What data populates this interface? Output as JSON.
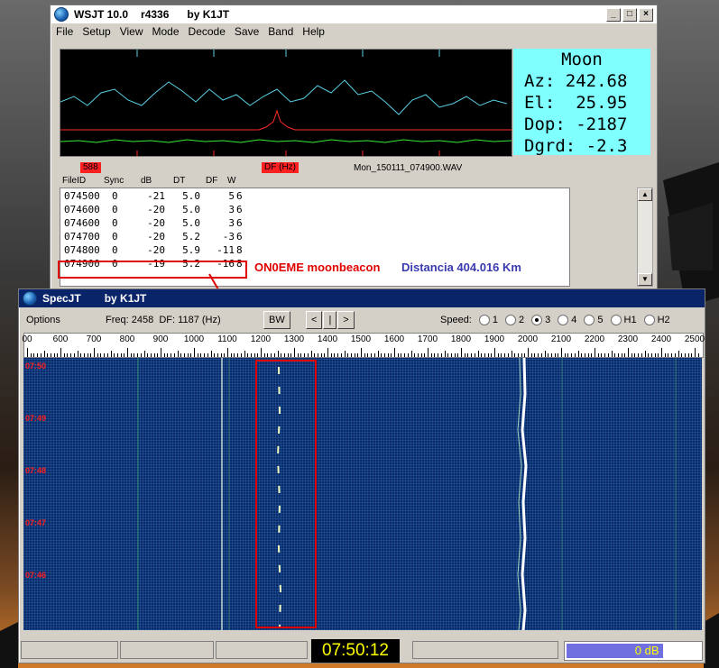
{
  "wsjt": {
    "title": "WSJT 10.0",
    "version": "r4336",
    "author": "by K1JT",
    "menu": [
      "File",
      "Setup",
      "View",
      "Mode",
      "Decode",
      "Save",
      "Band",
      "Help"
    ],
    "window_buttons": [
      "_",
      "□",
      "×"
    ],
    "moon": {
      "title": "Moon",
      "az": "Az: 242.68",
      "el": "El:  25.95",
      "dop": "Dop: -2187",
      "dgrd": "Dgrd: -2.3"
    },
    "tag_left": "588",
    "tag_df": "DF (Hz)",
    "filename": "Mon_150111_074900.WAV",
    "columns": [
      "FileID",
      "Sync",
      "dB",
      "DT",
      "DF",
      "W"
    ],
    "rows": [
      [
        "074500",
        "0",
        "-21",
        "5.0",
        "5",
        "6"
      ],
      [
        "074600",
        "0",
        "-20",
        "5.0",
        "3",
        "6"
      ],
      [
        "074600",
        "0",
        "-20",
        "5.0",
        "3",
        "6"
      ],
      [
        "074700",
        "0",
        "-20",
        "5.2",
        "-3",
        "6"
      ],
      [
        "074800",
        "0",
        "-20",
        "5.9",
        "-11",
        "8"
      ],
      [
        "074900",
        "0",
        "-19",
        "5.2",
        "-16",
        "8"
      ]
    ],
    "annotation_beacon": "ON0EME moonbeacon",
    "annotation_distance": "Distancia 404.016 Km"
  },
  "spec": {
    "title": "SpecJT",
    "author": "by K1JT",
    "options": "Options",
    "freq_label": "Freq:",
    "freq_value": "2458",
    "df_label": "DF:",
    "df_value": "1187",
    "df_unit": "(Hz)",
    "bw_button": "BW",
    "nav_buttons": [
      "<",
      "|",
      ">"
    ],
    "speed_label": "Speed:",
    "speed_options": [
      "1",
      "2",
      "3",
      "4",
      "5",
      "H1",
      "H2"
    ],
    "speed_selected": "3",
    "ruler_labels": [
      "00",
      "600",
      "700",
      "800",
      "900",
      "1000",
      "1100",
      "1200",
      "1300",
      "1400",
      "1500",
      "1600",
      "1700",
      "1800",
      "1900",
      "2000",
      "2100",
      "2200",
      "2300",
      "2400",
      "2500"
    ],
    "time_labels": [
      "07:50",
      "07:49",
      "07:48",
      "07:47",
      "07:46"
    ],
    "clock": "07:50:12",
    "level": "0 dB",
    "level_fraction": 0.72
  }
}
